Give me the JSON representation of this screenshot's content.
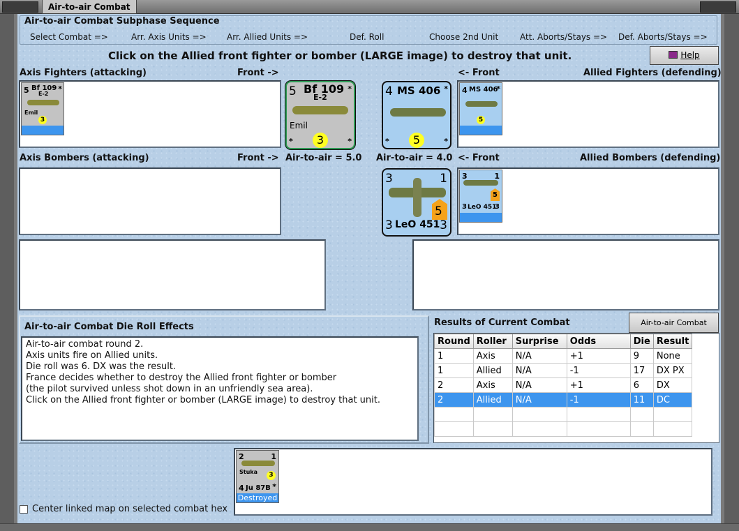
{
  "window": {
    "title": "Air-to-air Combat"
  },
  "sequence": {
    "title": "Air-to-air Combat Subphase Sequence",
    "steps": [
      "Select Combat =>",
      "Arr. Axis Units =>",
      "Arr. Allied Units =>",
      "Def. Roll",
      "Choose 2nd Unit",
      "Att. Aborts/Stays =>",
      "Def. Aborts/Stays =>"
    ]
  },
  "instruction": "Click on the Allied front fighter or bomber (LARGE image) to destroy that unit.",
  "help_button": {
    "label": "Help",
    "icon": "help-book-icon"
  },
  "axis_fighters": {
    "label": "Axis Fighters (attacking)",
    "front_label": "Front ->",
    "unit": {
      "strength": "5",
      "name": "Bf 109",
      "variant": "E-2",
      "nickname": "Emil",
      "rating": "3",
      "star": "*"
    }
  },
  "allied_fighters": {
    "label": "Allied Fighters (defending)",
    "front_label": "<- Front",
    "unit": {
      "strength": "4",
      "name": "MS 406",
      "rating": "5",
      "star": "*"
    }
  },
  "axis_bombers": {
    "label": "Axis Bombers (attacking)",
    "front_label": "Front ->"
  },
  "allied_bombers": {
    "label": "Allied Bombers (defending)",
    "front_label": "<- Front",
    "unit": {
      "top_left": "3",
      "top_right": "1",
      "bottom_left": "3",
      "bottom_right": "3",
      "name": "LeO 451",
      "rating": "5"
    }
  },
  "air_to_air_axis": "Air-to-air = 5.0",
  "air_to_air_allied": "Air-to-air = 4.0",
  "effects": {
    "title": "Air-to-air Combat Die Roll Effects",
    "lines": "Air-to-air combat round 2.\nAxis units fire on Allied units.\nDie roll was 6.  DX was the result.\nFrance decides whether to destroy the Allied front fighter or bomber\n(the pilot survived unless shot down in an unfriendly sea area).\nClick on the Allied front fighter or bomber (LARGE image) to destroy that unit."
  },
  "results": {
    "title": "Results of Current Combat",
    "chart_button": "Air-to-air Combat Chart",
    "columns": [
      "Round",
      "Roller",
      "Surprise",
      "Odds",
      "Die",
      "Result"
    ],
    "rows": [
      [
        "1",
        "Axis",
        "N/A",
        "+1",
        "9",
        "None"
      ],
      [
        "1",
        "Allied",
        "N/A",
        "-1",
        "17",
        "DX PX"
      ],
      [
        "2",
        "Axis",
        "N/A",
        "+1",
        "6",
        "DX"
      ],
      [
        "2",
        "Allied",
        "N/A",
        "-1",
        "11",
        "DC"
      ]
    ]
  },
  "destroyed_unit": {
    "top_left": "2",
    "top_right": "1",
    "bottom_left": "4",
    "name": "Ju 87B",
    "nickname": "Stuka",
    "rating": "3",
    "star": "*",
    "status": "Destroyed"
  },
  "center_map_checkbox": {
    "label": "Center linked map on selected combat hex",
    "checked": false
  },
  "colors": {
    "selected": "#3d95ee",
    "background": "#b8cfe6",
    "rating_dot": "#ffff22",
    "allied_counter": "#a8cff0",
    "axis_counter": "#c3c3c3"
  }
}
